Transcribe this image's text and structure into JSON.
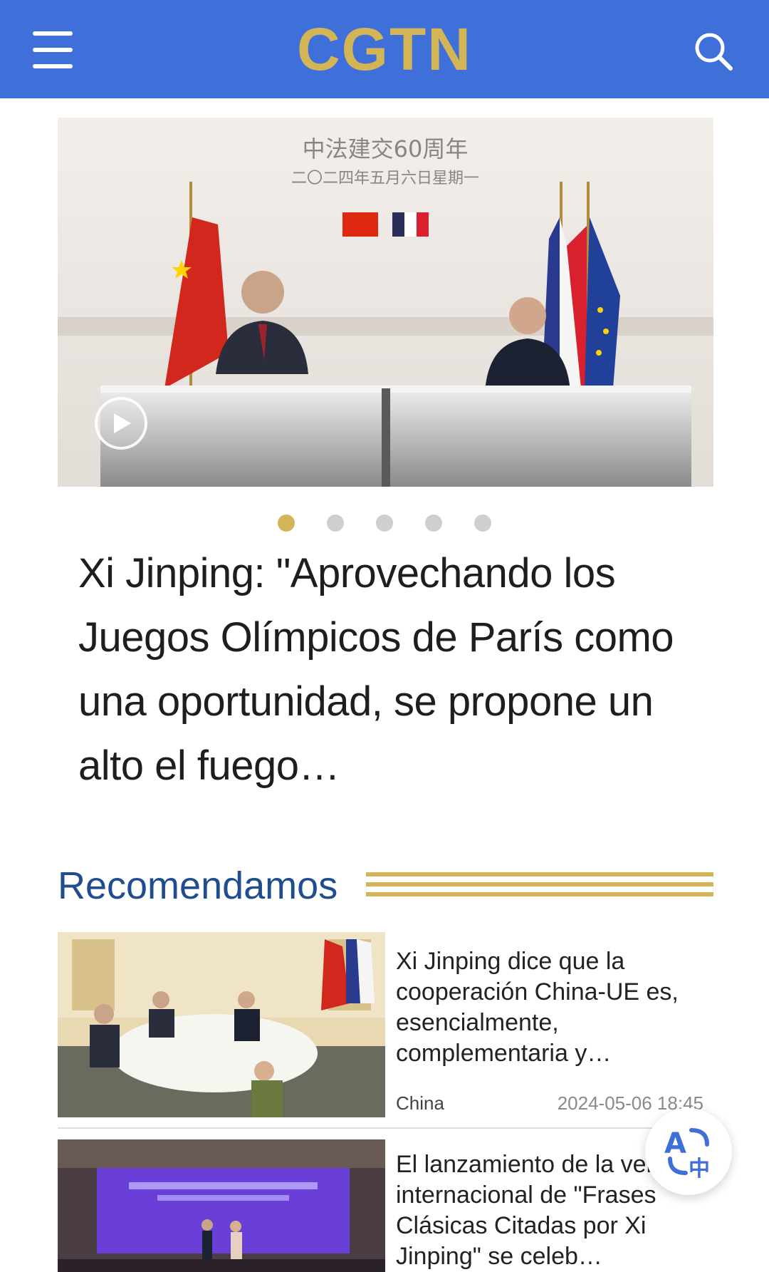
{
  "header": {
    "logo": "CGTN",
    "menu_icon": "hamburger-menu-icon",
    "search_icon": "search-icon",
    "brand_color": "#3f6fd8",
    "logo_color": "#d4b556"
  },
  "hero": {
    "backdrop_line1": "中法建交60周年",
    "backdrop_line2": "二〇二四年五月六日星期一",
    "play_icon": "play-icon",
    "slides_total": 5,
    "active_slide": 1,
    "headline": "Xi Jinping: \"Aprovechando los Juegos Olímpicos de París como una oportunidad, se propone un alto el fuego…"
  },
  "section": {
    "title": "Recomendamos",
    "title_color": "#1f4d8e"
  },
  "articles": [
    {
      "title": "Xi Jinping dice que la cooperación China-UE es, esencialmente, complementaria y…",
      "category": "China",
      "date": "2024-05-06 18:45"
    },
    {
      "title": "El lanzamiento de la versión internacional de \"Frases Clásicas Citadas por Xi Jinping\" se celeb…"
    }
  ],
  "translate_icon": "translate-icon"
}
